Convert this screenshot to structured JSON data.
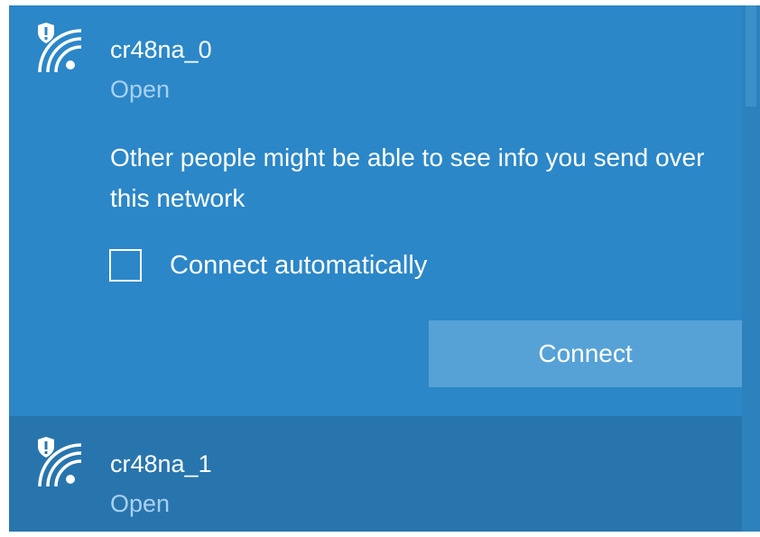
{
  "networks": [
    {
      "name": "cr48na_0",
      "status": "Open",
      "warning": "Other people might be able to see info you send over this network",
      "connect_automatically_label": "Connect automatically",
      "connect_automatically_checked": false,
      "connect_label": "Connect",
      "icon": "wifi-secured-warning-icon"
    },
    {
      "name": "cr48na_1",
      "status": "Open",
      "icon": "wifi-secured-warning-icon"
    }
  ],
  "colors": {
    "expanded_bg": "#2b87c8",
    "collapsed_bg": "#2875ae",
    "status_text": "#a9d0ef",
    "button_bg": "#56a2d6"
  }
}
